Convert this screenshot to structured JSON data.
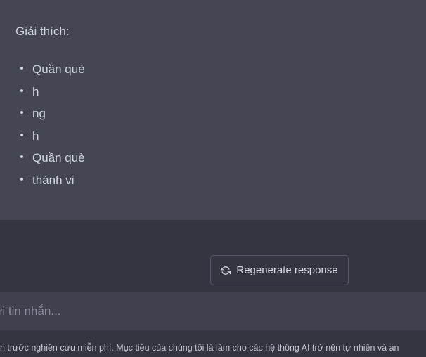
{
  "message": {
    "heading": "Giải thích:",
    "items": [
      "Quần què",
      "h",
      "ng",
      "h",
      "Quần què",
      "thành vi"
    ]
  },
  "composer": {
    "regenerate_label": "Regenerate response",
    "regenerate_icon": "refresh-icon",
    "input_placeholder": "ửi tin nhắn..."
  },
  "footer": {
    "disclaimer": "n trước nghiên cứu miễn phí. Mục tiêu của chúng tôi là làm cho các hệ thống AI trở nên tự nhiên và an"
  },
  "colors": {
    "message_bg": "#444654",
    "page_bg": "#343541",
    "input_bg": "#40414f",
    "text": "#d1d5db"
  }
}
